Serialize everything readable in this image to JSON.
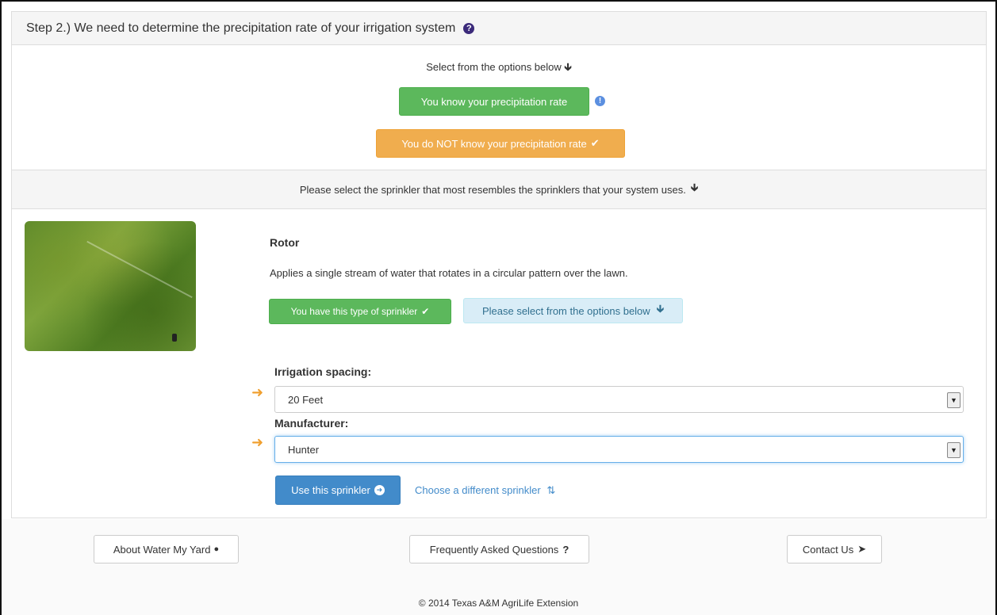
{
  "step": {
    "title": "Step 2.)  We need to determine the precipitation rate of your irrigation system",
    "help_icon": "question-circle-icon"
  },
  "options": {
    "prompt": "Select from the options below",
    "prompt_icon": "arrow-down-icon",
    "know_button": "You know your precipitation rate",
    "dont_know_button": "You do NOT know your precipitation rate",
    "dont_know_icon": "check-icon",
    "info_icon": "info-circle-icon"
  },
  "sprinkler_prompt": "Please select the sprinkler that most resembles the sprinklers that your system uses.",
  "sprinkler": {
    "name": "Rotor",
    "description": "Applies a single stream of water that rotates in a circular pattern over the lawn.",
    "have_button": "You have this type of sprinkler",
    "select_notice": "Please select from the options below"
  },
  "form": {
    "spacing_label": "Irrigation spacing:",
    "spacing_value": "20 Feet",
    "manufacturer_label": "Manufacturer:",
    "manufacturer_value": "Hunter",
    "use_button": "Use this sprinkler",
    "choose_link": "Choose a different sprinkler"
  },
  "footer": {
    "about": "About Water My Yard",
    "faq": "Frequently Asked Questions",
    "contact": "Contact Us",
    "copyright": "© 2014 Texas A&M AgriLife Extension"
  },
  "colors": {
    "green": "#5cb85c",
    "orange": "#f0ad4e",
    "blue": "#428bca",
    "info_bg": "#d9edf7"
  }
}
